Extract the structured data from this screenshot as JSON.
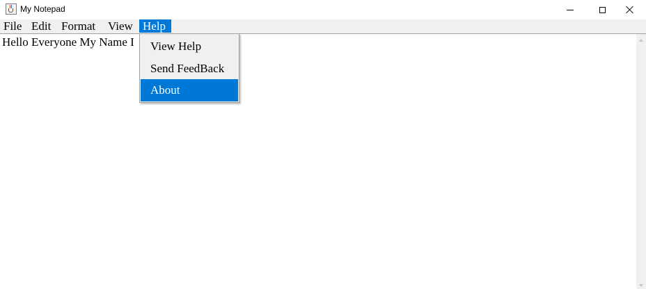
{
  "window": {
    "title": "My Notepad",
    "icon": "java-cup-icon",
    "controls": [
      "minimize-icon",
      "maximize-icon",
      "close-icon"
    ]
  },
  "menubar": {
    "items": [
      {
        "label": "File"
      },
      {
        "label": "Edit"
      },
      {
        "label": "Format"
      },
      {
        "label": "View"
      },
      {
        "label": "Help",
        "active": true
      }
    ]
  },
  "editor": {
    "text": "Hello Everyone My Name I"
  },
  "help_menu": {
    "items": [
      {
        "label": "View Help"
      },
      {
        "label": "Send FeedBack"
      },
      {
        "label": "About",
        "highlighted": true
      }
    ]
  },
  "colors": {
    "accent": "#0078d7",
    "menubar_bg": "#f0f0f0",
    "editor_bg": "#ffffff"
  }
}
